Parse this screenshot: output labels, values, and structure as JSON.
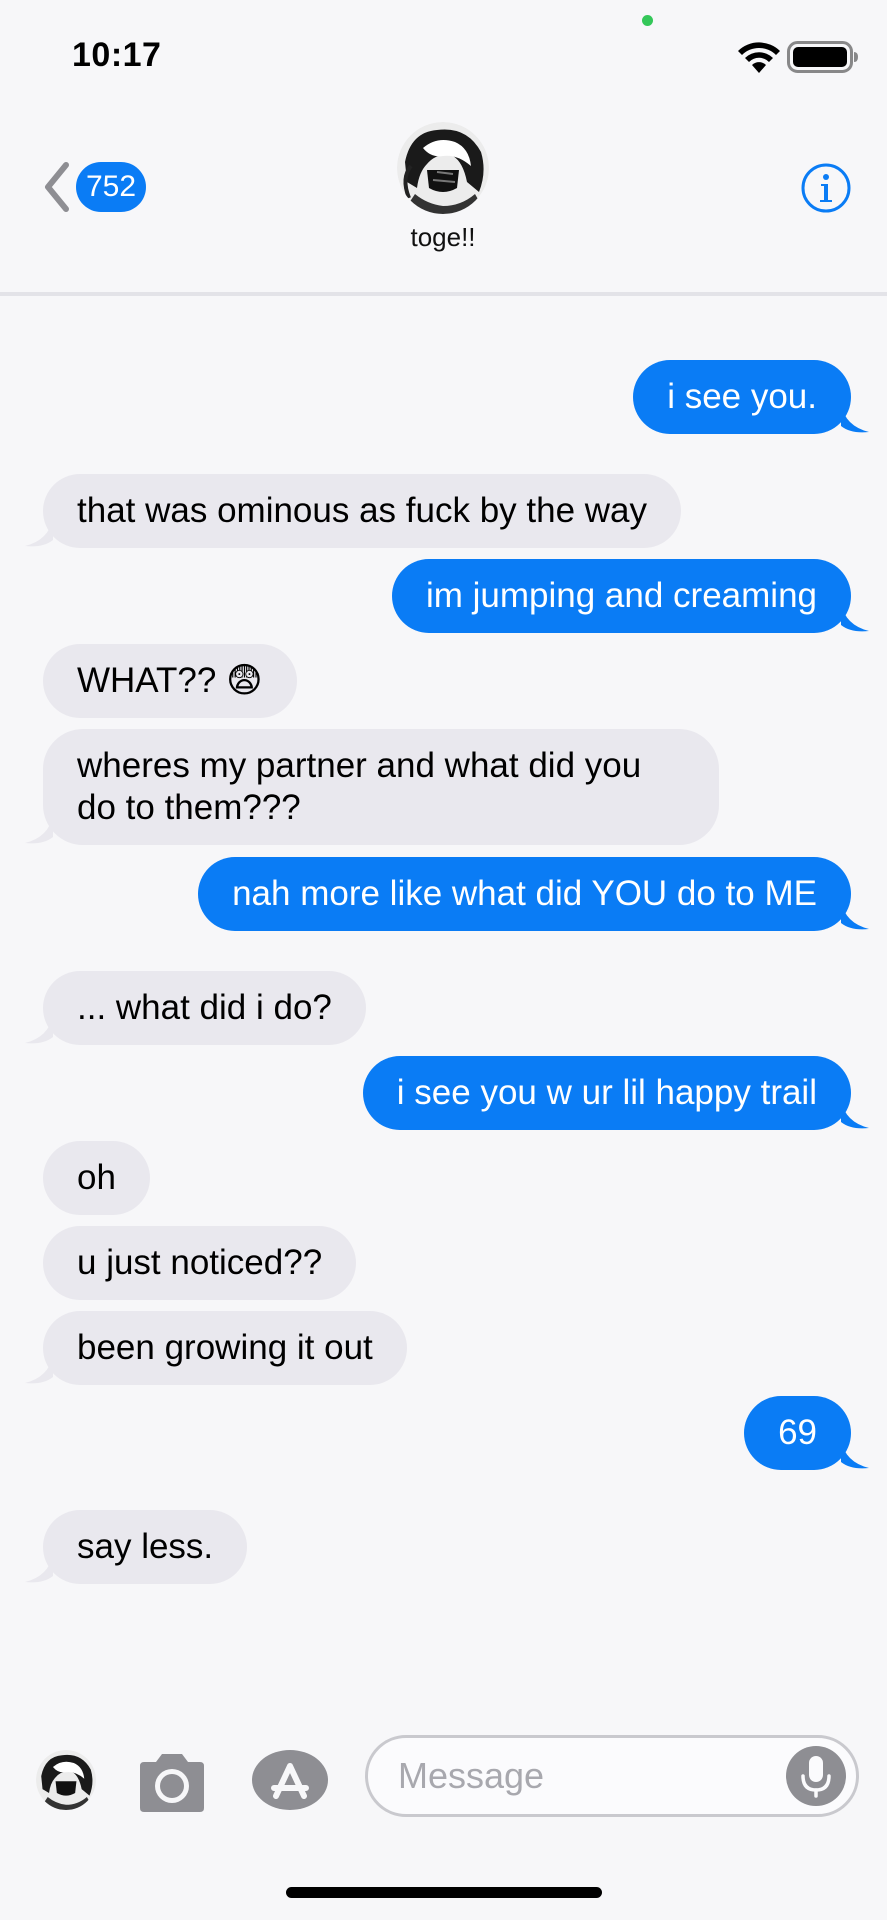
{
  "status_bar": {
    "time": "10:17",
    "privacy_dot_color": "#34c759"
  },
  "header": {
    "back_icon": "chevron-left-icon",
    "unread_count": "752",
    "contact_name": "toge!!",
    "info_icon": "info-icon",
    "accent_color": "#0a7cf5"
  },
  "messages": [
    {
      "text": "i see you.",
      "direction": "outgoing"
    },
    {
      "text": "that was ominous as fuck by the way",
      "direction": "incoming"
    },
    {
      "text": "im jumping and creaming",
      "direction": "outgoing"
    },
    {
      "text": "WHAT?? 😨",
      "direction": "incoming"
    },
    {
      "text": "wheres my partner and what did you",
      "direction": "incoming"
    },
    {
      "text": "do to them???",
      "direction": "incoming"
    },
    {
      "text": "nah more like what did YOU do to ME",
      "direction": "outgoing"
    },
    {
      "text": "... what did i do?",
      "direction": "incoming"
    },
    {
      "text": "i see you w ur lil happy trail",
      "direction": "outgoing"
    },
    {
      "text": "oh",
      "direction": "incoming"
    },
    {
      "text": "u just noticed??",
      "direction": "incoming"
    },
    {
      "text": "been growing it out",
      "direction": "incoming"
    },
    {
      "text": "69",
      "direction": "outgoing"
    },
    {
      "text": "say less.",
      "direction": "incoming"
    }
  ],
  "composer": {
    "placeholder": "Message",
    "icons": [
      "avatar",
      "camera-icon",
      "appstore-icon",
      "microphone-icon"
    ]
  },
  "colors": {
    "outgoing_bubble": "#0a7cf5",
    "incoming_bubble": "#e9e8ee",
    "background": "#f7f7f9"
  }
}
